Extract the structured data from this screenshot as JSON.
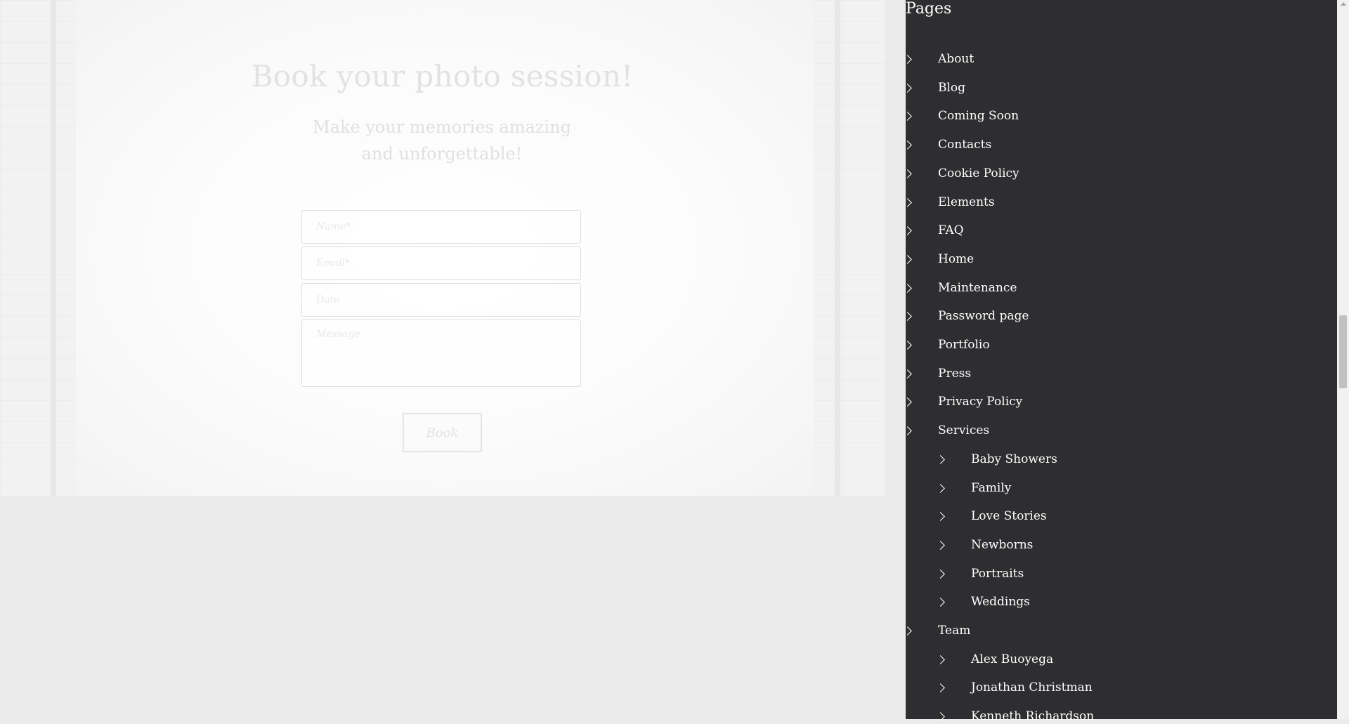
{
  "booking": {
    "title": "Book your photo session!",
    "subtitle": "Make your memories amazing and unforgettable!",
    "fields": {
      "name_placeholder": "Name*",
      "email_placeholder": "Email*",
      "date_placeholder": "Date",
      "message_placeholder": "Message"
    },
    "button_label": "Book"
  },
  "panel": {
    "title": "Pages",
    "items": [
      {
        "label": "About",
        "level": 0
      },
      {
        "label": "Blog",
        "level": 0
      },
      {
        "label": "Coming Soon",
        "level": 0
      },
      {
        "label": "Contacts",
        "level": 0
      },
      {
        "label": "Cookie Policy",
        "level": 0
      },
      {
        "label": "Elements",
        "level": 0
      },
      {
        "label": "FAQ",
        "level": 0
      },
      {
        "label": "Home",
        "level": 0
      },
      {
        "label": "Maintenance",
        "level": 0
      },
      {
        "label": "Password page",
        "level": 0
      },
      {
        "label": "Portfolio",
        "level": 0
      },
      {
        "label": "Press",
        "level": 0
      },
      {
        "label": "Privacy Policy",
        "level": 0
      },
      {
        "label": "Services",
        "level": 0
      },
      {
        "label": "Baby Showers",
        "level": 1
      },
      {
        "label": "Family",
        "level": 1
      },
      {
        "label": "Love Stories",
        "level": 1
      },
      {
        "label": "Newborns",
        "level": 1
      },
      {
        "label": "Portraits",
        "level": 1
      },
      {
        "label": "Weddings",
        "level": 1
      },
      {
        "label": "Team",
        "level": 0
      },
      {
        "label": "Alex Buoyega",
        "level": 1
      },
      {
        "label": "Jonathan Christman",
        "level": 1
      },
      {
        "label": "Kenneth Richardson",
        "level": 1
      }
    ]
  },
  "colors": {
    "panel_bg": "#2e2e31",
    "page_bg": "#ebebeb"
  }
}
